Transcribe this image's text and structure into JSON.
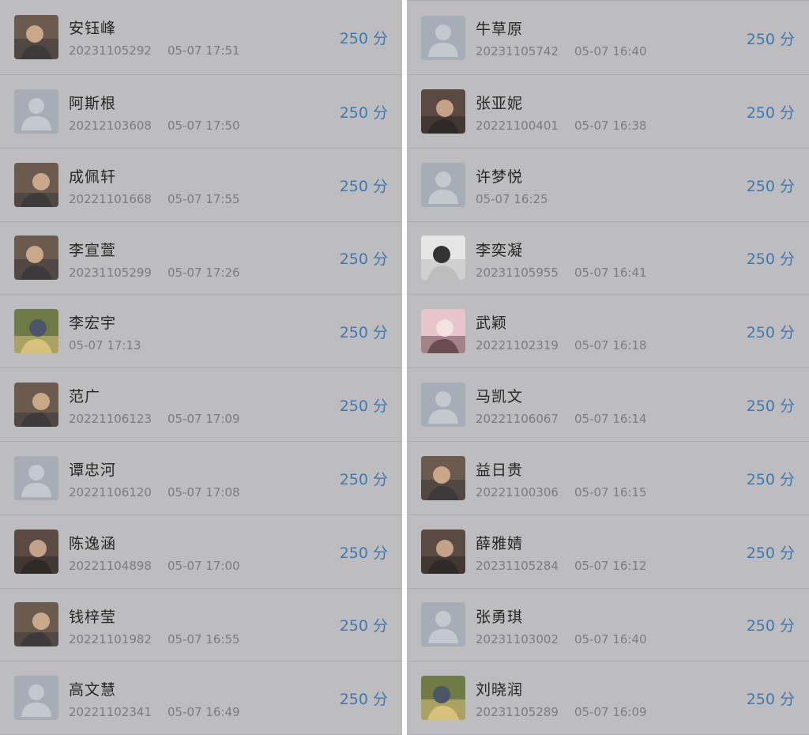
{
  "score_unit": "分",
  "left_column": [
    {
      "name": "安钰峰",
      "student_id": "20231105292",
      "time": "05-07 17:51",
      "score": "250",
      "avatar": "photo-avatar"
    },
    {
      "name": "阿斯根",
      "student_id": "20212103608",
      "time": "05-07 17:50",
      "score": "250",
      "avatar": "default-avatar"
    },
    {
      "name": "成佩轩",
      "student_id": "20221101668",
      "time": "05-07 17:55",
      "score": "250",
      "avatar": "photo-avatar"
    },
    {
      "name": "李宣萱",
      "student_id": "20231105299",
      "time": "05-07 17:26",
      "score": "250",
      "avatar": "photo-avatar"
    },
    {
      "name": "李宏宇",
      "student_id": "",
      "time": "05-07 17:13",
      "score": "250",
      "avatar": "cartoon-avatar"
    },
    {
      "name": "范广",
      "student_id": "20221106123",
      "time": "05-07 17:09",
      "score": "250",
      "avatar": "photo-avatar"
    },
    {
      "name": "谭忠河",
      "student_id": "20221106120",
      "time": "05-07 17:08",
      "score": "250",
      "avatar": "default-avatar"
    },
    {
      "name": "陈逸涵",
      "student_id": "20221104898",
      "time": "05-07 17:00",
      "score": "250",
      "avatar": "illustration-avatar"
    },
    {
      "name": "钱梓莹",
      "student_id": "20221101982",
      "time": "05-07 16:55",
      "score": "250",
      "avatar": "photo-avatar"
    },
    {
      "name": "高文慧",
      "student_id": "20221102341",
      "time": "05-07 16:49",
      "score": "250",
      "avatar": "default-avatar"
    }
  ],
  "right_column": [
    {
      "name": "牛草原",
      "student_id": "20231105742",
      "time": "05-07 16:40",
      "score": "250",
      "avatar": "default-avatar"
    },
    {
      "name": "张亚妮",
      "student_id": "20221100401",
      "time": "05-07 16:38",
      "score": "250",
      "avatar": "illustration-avatar"
    },
    {
      "name": "许梦悦",
      "student_id": "",
      "time": "05-07 16:25",
      "score": "250",
      "avatar": "default-avatar"
    },
    {
      "name": "李奕凝",
      "student_id": "20231105955",
      "time": "05-07 16:41",
      "score": "250",
      "avatar": "sketch-avatar"
    },
    {
      "name": "武颖",
      "student_id": "20221102319",
      "time": "05-07 16:18",
      "score": "250",
      "avatar": "anime-avatar"
    },
    {
      "name": "马凯文",
      "student_id": "20221106067",
      "time": "05-07 16:14",
      "score": "250",
      "avatar": "default-avatar"
    },
    {
      "name": "益日贵",
      "student_id": "20221100306",
      "time": "05-07 16:15",
      "score": "250",
      "avatar": "photo-avatar"
    },
    {
      "name": "薛雅婧",
      "student_id": "20231105284",
      "time": "05-07 16:12",
      "score": "250",
      "avatar": "illustration-avatar"
    },
    {
      "name": "张勇琪",
      "student_id": "20231103002",
      "time": "05-07 16:40",
      "score": "250",
      "avatar": "default-avatar"
    },
    {
      "name": "刘晓润",
      "student_id": "20231105289",
      "time": "05-07 16:09",
      "score": "250",
      "avatar": "cartoon-avatar"
    }
  ]
}
